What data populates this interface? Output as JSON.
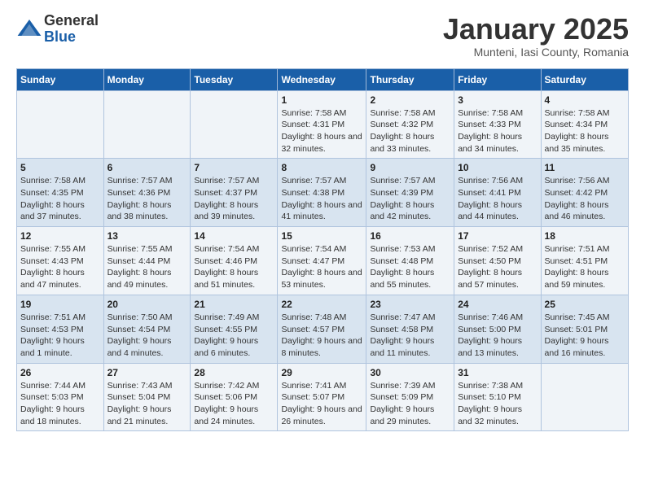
{
  "logo": {
    "general": "General",
    "blue": "Blue"
  },
  "header": {
    "month": "January 2025",
    "location": "Munteni, Iasi County, Romania"
  },
  "days_of_week": [
    "Sunday",
    "Monday",
    "Tuesday",
    "Wednesday",
    "Thursday",
    "Friday",
    "Saturday"
  ],
  "weeks": [
    [
      {
        "day": "",
        "info": ""
      },
      {
        "day": "",
        "info": ""
      },
      {
        "day": "",
        "info": ""
      },
      {
        "day": "1",
        "info": "Sunrise: 7:58 AM\nSunset: 4:31 PM\nDaylight: 8 hours and 32 minutes."
      },
      {
        "day": "2",
        "info": "Sunrise: 7:58 AM\nSunset: 4:32 PM\nDaylight: 8 hours and 33 minutes."
      },
      {
        "day": "3",
        "info": "Sunrise: 7:58 AM\nSunset: 4:33 PM\nDaylight: 8 hours and 34 minutes."
      },
      {
        "day": "4",
        "info": "Sunrise: 7:58 AM\nSunset: 4:34 PM\nDaylight: 8 hours and 35 minutes."
      }
    ],
    [
      {
        "day": "5",
        "info": "Sunrise: 7:58 AM\nSunset: 4:35 PM\nDaylight: 8 hours and 37 minutes."
      },
      {
        "day": "6",
        "info": "Sunrise: 7:57 AM\nSunset: 4:36 PM\nDaylight: 8 hours and 38 minutes."
      },
      {
        "day": "7",
        "info": "Sunrise: 7:57 AM\nSunset: 4:37 PM\nDaylight: 8 hours and 39 minutes."
      },
      {
        "day": "8",
        "info": "Sunrise: 7:57 AM\nSunset: 4:38 PM\nDaylight: 8 hours and 41 minutes."
      },
      {
        "day": "9",
        "info": "Sunrise: 7:57 AM\nSunset: 4:39 PM\nDaylight: 8 hours and 42 minutes."
      },
      {
        "day": "10",
        "info": "Sunrise: 7:56 AM\nSunset: 4:41 PM\nDaylight: 8 hours and 44 minutes."
      },
      {
        "day": "11",
        "info": "Sunrise: 7:56 AM\nSunset: 4:42 PM\nDaylight: 8 hours and 46 minutes."
      }
    ],
    [
      {
        "day": "12",
        "info": "Sunrise: 7:55 AM\nSunset: 4:43 PM\nDaylight: 8 hours and 47 minutes."
      },
      {
        "day": "13",
        "info": "Sunrise: 7:55 AM\nSunset: 4:44 PM\nDaylight: 8 hours and 49 minutes."
      },
      {
        "day": "14",
        "info": "Sunrise: 7:54 AM\nSunset: 4:46 PM\nDaylight: 8 hours and 51 minutes."
      },
      {
        "day": "15",
        "info": "Sunrise: 7:54 AM\nSunset: 4:47 PM\nDaylight: 8 hours and 53 minutes."
      },
      {
        "day": "16",
        "info": "Sunrise: 7:53 AM\nSunset: 4:48 PM\nDaylight: 8 hours and 55 minutes."
      },
      {
        "day": "17",
        "info": "Sunrise: 7:52 AM\nSunset: 4:50 PM\nDaylight: 8 hours and 57 minutes."
      },
      {
        "day": "18",
        "info": "Sunrise: 7:51 AM\nSunset: 4:51 PM\nDaylight: 8 hours and 59 minutes."
      }
    ],
    [
      {
        "day": "19",
        "info": "Sunrise: 7:51 AM\nSunset: 4:53 PM\nDaylight: 9 hours and 1 minute."
      },
      {
        "day": "20",
        "info": "Sunrise: 7:50 AM\nSunset: 4:54 PM\nDaylight: 9 hours and 4 minutes."
      },
      {
        "day": "21",
        "info": "Sunrise: 7:49 AM\nSunset: 4:55 PM\nDaylight: 9 hours and 6 minutes."
      },
      {
        "day": "22",
        "info": "Sunrise: 7:48 AM\nSunset: 4:57 PM\nDaylight: 9 hours and 8 minutes."
      },
      {
        "day": "23",
        "info": "Sunrise: 7:47 AM\nSunset: 4:58 PM\nDaylight: 9 hours and 11 minutes."
      },
      {
        "day": "24",
        "info": "Sunrise: 7:46 AM\nSunset: 5:00 PM\nDaylight: 9 hours and 13 minutes."
      },
      {
        "day": "25",
        "info": "Sunrise: 7:45 AM\nSunset: 5:01 PM\nDaylight: 9 hours and 16 minutes."
      }
    ],
    [
      {
        "day": "26",
        "info": "Sunrise: 7:44 AM\nSunset: 5:03 PM\nDaylight: 9 hours and 18 minutes."
      },
      {
        "day": "27",
        "info": "Sunrise: 7:43 AM\nSunset: 5:04 PM\nDaylight: 9 hours and 21 minutes."
      },
      {
        "day": "28",
        "info": "Sunrise: 7:42 AM\nSunset: 5:06 PM\nDaylight: 9 hours and 24 minutes."
      },
      {
        "day": "29",
        "info": "Sunrise: 7:41 AM\nSunset: 5:07 PM\nDaylight: 9 hours and 26 minutes."
      },
      {
        "day": "30",
        "info": "Sunrise: 7:39 AM\nSunset: 5:09 PM\nDaylight: 9 hours and 29 minutes."
      },
      {
        "day": "31",
        "info": "Sunrise: 7:38 AM\nSunset: 5:10 PM\nDaylight: 9 hours and 32 minutes."
      },
      {
        "day": "",
        "info": ""
      }
    ]
  ]
}
